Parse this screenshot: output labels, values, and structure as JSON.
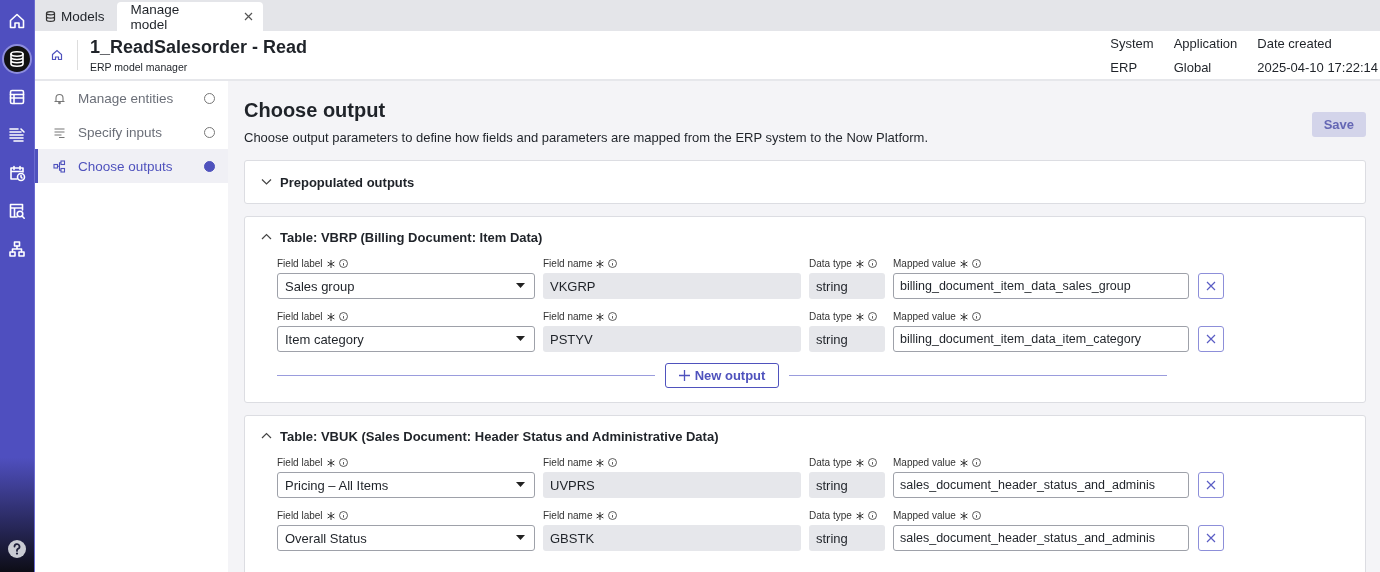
{
  "rail": [
    {
      "selected": false
    },
    {
      "selected": true
    },
    {
      "selected": false
    },
    {
      "selected": false
    },
    {
      "selected": false
    },
    {
      "selected": false
    },
    {
      "selected": false
    },
    {
      "selected": false
    }
  ],
  "tabs": [
    {
      "label": "Models",
      "selected": false,
      "closable": false
    },
    {
      "label": "Manage model",
      "selected": true,
      "closable": true
    }
  ],
  "header": {
    "title": "1_ReadSalesorder - Read",
    "subtitle": "ERP model manager",
    "meta": [
      {
        "label": "System",
        "value": "ERP"
      },
      {
        "label": "Application",
        "value": "Global"
      },
      {
        "label": "Date created",
        "value": "2025-04-10 17:22:14"
      }
    ]
  },
  "steps": [
    {
      "label": "Manage entities",
      "selected": false
    },
    {
      "label": "Specify inputs",
      "selected": false
    },
    {
      "label": "Choose outputs",
      "selected": true
    }
  ],
  "page": {
    "title": "Choose output",
    "description": "Choose output parameters to define how fields and parameters are mapped from the ERP system to the Now Platform.",
    "save": {
      "label": "Save",
      "disabled": true
    }
  },
  "sections": [
    {
      "title": "Prepopulated outputs",
      "expanded": false
    },
    {
      "title": "Table: VBRP (Billing Document: Item Data)",
      "expanded": true,
      "new_output": "New output",
      "rows": [
        {
          "fields": [
            {
              "kind": "dropdown",
              "label": "Field label",
              "value": "Sales group"
            },
            {
              "kind": "readonly",
              "label": "Field name",
              "value": "VKGRP"
            },
            {
              "kind": "readonly",
              "label": "Data type",
              "value": "string"
            },
            {
              "kind": "text",
              "label": "Mapped value",
              "value": "billing_document_item_data_sales_group"
            }
          ]
        },
        {
          "fields": [
            {
              "kind": "dropdown",
              "label": "Field label",
              "value": "Item category"
            },
            {
              "kind": "readonly",
              "label": "Field name",
              "value": "PSTYV"
            },
            {
              "kind": "readonly",
              "label": "Data type",
              "value": "string"
            },
            {
              "kind": "text",
              "label": "Mapped value",
              "value": "billing_document_item_data_item_category"
            }
          ]
        }
      ]
    },
    {
      "title": "Table: VBUK (Sales Document: Header Status and Administrative Data)",
      "expanded": true,
      "rows": [
        {
          "fields": [
            {
              "kind": "dropdown",
              "label": "Field label",
              "value": "Pricing – All Items"
            },
            {
              "kind": "readonly",
              "label": "Field name",
              "value": "UVPRS"
            },
            {
              "kind": "readonly",
              "label": "Data type",
              "value": "string"
            },
            {
              "kind": "text",
              "label": "Mapped value",
              "value": "sales_document_header_status_and_adminis"
            }
          ]
        },
        {
          "fields": [
            {
              "kind": "dropdown",
              "label": "Field label",
              "value": "Overall Status"
            },
            {
              "kind": "readonly",
              "label": "Field name",
              "value": "GBSTK"
            },
            {
              "kind": "readonly",
              "label": "Data type",
              "value": "string"
            },
            {
              "kind": "text",
              "label": "Mapped value",
              "value": "sales_document_header_status_and_adminis"
            }
          ]
        }
      ]
    }
  ]
}
